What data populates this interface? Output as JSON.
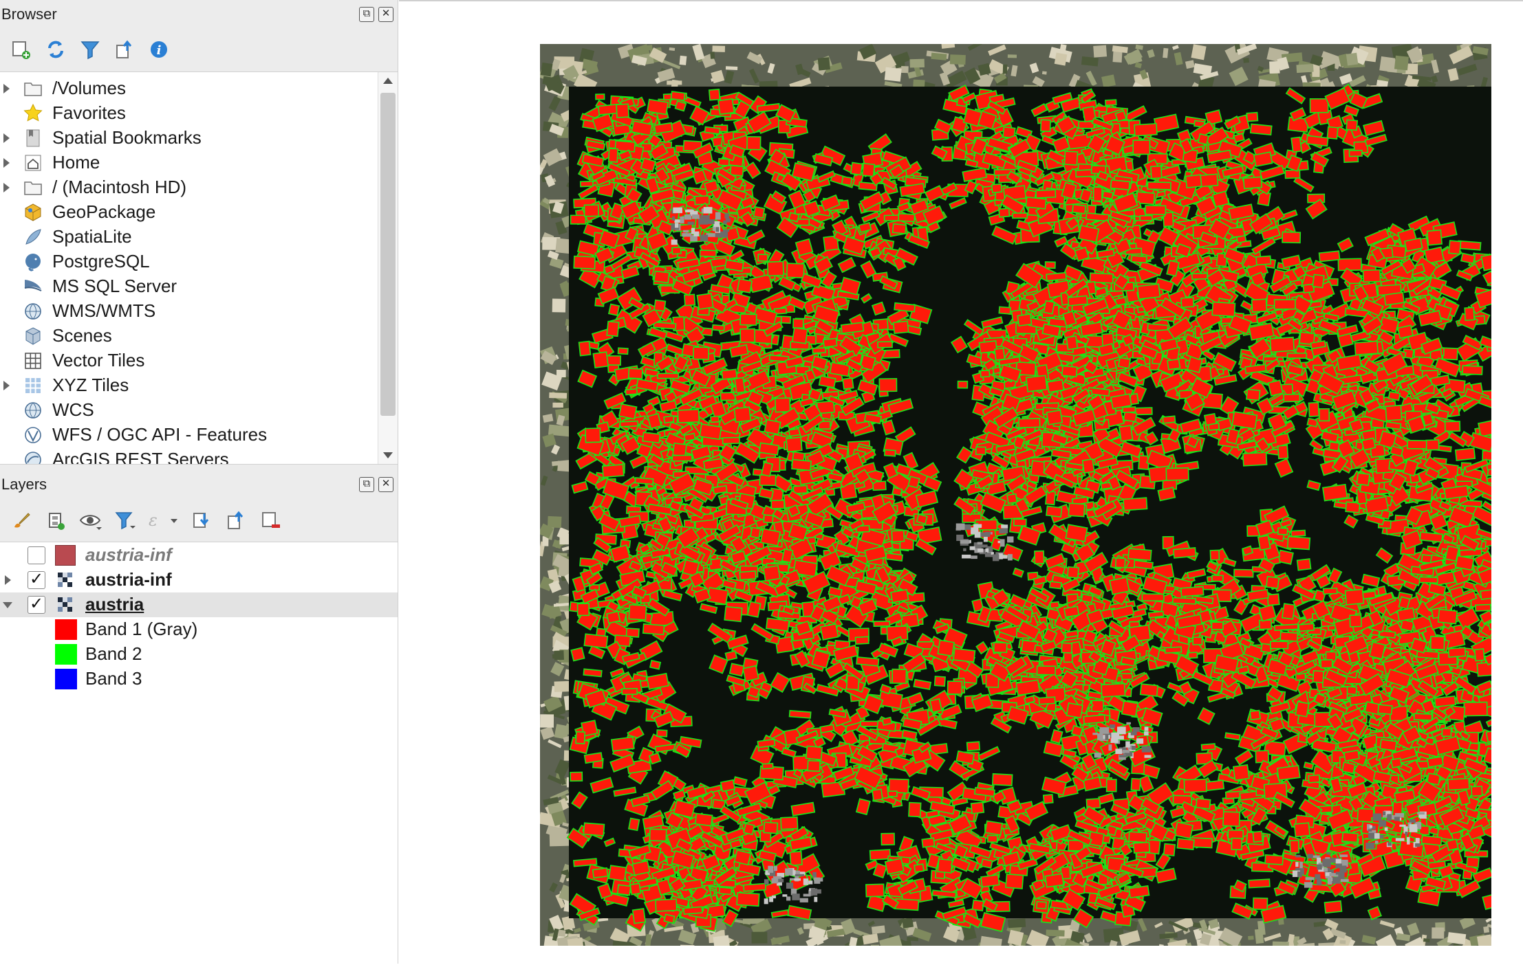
{
  "browser": {
    "title": "Browser",
    "items": [
      {
        "label": "/Volumes",
        "icon": "folder-icon",
        "expandable": true
      },
      {
        "label": "Favorites",
        "icon": "star-icon",
        "expandable": false
      },
      {
        "label": "Spatial Bookmarks",
        "icon": "bookmark-icon",
        "expandable": true
      },
      {
        "label": "Home",
        "icon": "home-icon",
        "expandable": true
      },
      {
        "label": "/ (Macintosh HD)",
        "icon": "folder-icon",
        "expandable": true
      },
      {
        "label": "GeoPackage",
        "icon": "geopackage-icon",
        "expandable": false
      },
      {
        "label": "SpatiaLite",
        "icon": "spatialite-icon",
        "expandable": false
      },
      {
        "label": "PostgreSQL",
        "icon": "postgresql-icon",
        "expandable": false
      },
      {
        "label": "MS SQL Server",
        "icon": "mssql-icon",
        "expandable": false
      },
      {
        "label": "WMS/WMTS",
        "icon": "globe-icon",
        "expandable": false
      },
      {
        "label": "Scenes",
        "icon": "cube-icon",
        "expandable": false
      },
      {
        "label": "Vector Tiles",
        "icon": "grid-icon",
        "expandable": false
      },
      {
        "label": "XYZ Tiles",
        "icon": "xyz-grid-icon",
        "expandable": true
      },
      {
        "label": "WCS",
        "icon": "globe-icon",
        "expandable": false
      },
      {
        "label": "WFS / OGC API - Features",
        "icon": "wfs-icon",
        "expandable": false
      },
      {
        "label": "ArcGIS REST Servers",
        "icon": "arcgis-icon",
        "expandable": false
      }
    ]
  },
  "layers": {
    "title": "Layers",
    "items": [
      {
        "label": "austria-inf",
        "checked": false,
        "style": "italic-gray",
        "icon": "polygon-layer-icon",
        "expanded": null
      },
      {
        "label": "austria-inf",
        "checked": true,
        "style": "bold",
        "icon": "raster-layer-icon",
        "expanded": false
      },
      {
        "label": "austria",
        "checked": true,
        "style": "bold-underline",
        "icon": "raster-layer-icon",
        "expanded": true
      }
    ],
    "bands": [
      {
        "label": "Band 1 (Gray)",
        "color": "#ff0000"
      },
      {
        "label": "Band 2",
        "color": "#00ff00"
      },
      {
        "label": "Band 3",
        "color": "#0000ff"
      }
    ]
  },
  "colors": {
    "field_red": "#ff1a0a",
    "boundary_green": "#19e619",
    "forest_dark": "#0c120c",
    "polygon_layer_swatch": "#b94a50"
  }
}
